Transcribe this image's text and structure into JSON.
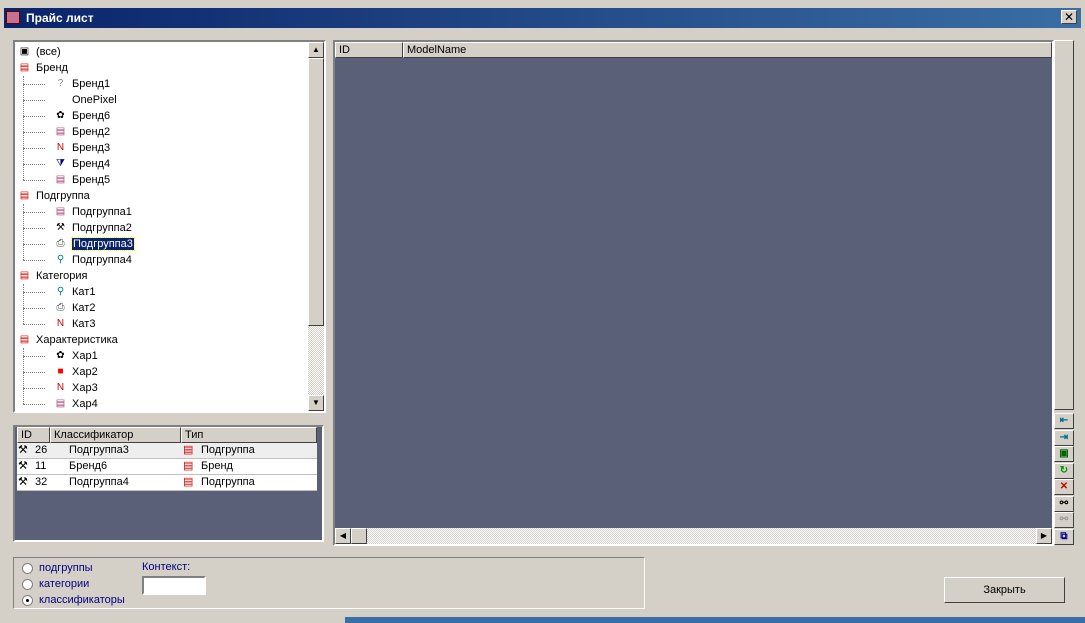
{
  "window": {
    "title": "Прайс лист"
  },
  "tree": {
    "items": [
      {
        "label": "(все)",
        "level": 0,
        "icon": "all-icon"
      },
      {
        "label": "Бренд",
        "level": 0,
        "icon": "md-folder-icon"
      },
      {
        "label": "Бренд1",
        "level": 1,
        "icon": "question-icon"
      },
      {
        "label": "OnePixel",
        "level": 1,
        "icon": "none"
      },
      {
        "label": "Бренд6",
        "level": 1,
        "icon": "flower-icon"
      },
      {
        "label": "Бренд2",
        "level": 1,
        "icon": "form-icon"
      },
      {
        "label": "Бренд3",
        "level": 1,
        "icon": "new-badge-icon"
      },
      {
        "label": "Бренд4",
        "level": 1,
        "icon": "filter-icon"
      },
      {
        "label": "Бренд5",
        "level": 1,
        "icon": "form-icon"
      },
      {
        "label": "Подгруппа",
        "level": 0,
        "icon": "md-folder-icon"
      },
      {
        "label": "Подгруппа1",
        "level": 1,
        "icon": "form-icon"
      },
      {
        "label": "Подгруппа2",
        "level": 1,
        "icon": "tools-icon"
      },
      {
        "label": "Подгруппа3",
        "level": 1,
        "icon": "printer-icon",
        "selected": true
      },
      {
        "label": "Подгруппа4",
        "level": 1,
        "icon": "tool-icon"
      },
      {
        "label": "Категория",
        "level": 0,
        "icon": "md-folder-icon"
      },
      {
        "label": "Кат1",
        "level": 1,
        "icon": "tool-icon"
      },
      {
        "label": "Кат2",
        "level": 1,
        "icon": "printer-icon"
      },
      {
        "label": "Кат3",
        "level": 1,
        "icon": "new-badge-icon"
      },
      {
        "label": "Характеристика",
        "level": 0,
        "icon": "md-folder-icon"
      },
      {
        "label": "Хар1",
        "level": 1,
        "icon": "flower-icon"
      },
      {
        "label": "Хар2",
        "level": 1,
        "icon": "red-square-icon"
      },
      {
        "label": "Хар3",
        "level": 1,
        "icon": "new-badge-icon"
      },
      {
        "label": "Хар4",
        "level": 1,
        "icon": "form-icon"
      }
    ]
  },
  "classifier_grid": {
    "columns": [
      "ID",
      "Классификатор",
      "Тип"
    ],
    "rows": [
      {
        "id": "26",
        "name": "Подгруппа3",
        "type": "Подгруппа"
      },
      {
        "id": "11",
        "name": "Бренд6",
        "type": "Бренд"
      },
      {
        "id": "32",
        "name": "Подгруппа4",
        "type": "Подгруппа"
      }
    ]
  },
  "main_grid": {
    "columns": [
      "ID",
      "ModelName"
    ]
  },
  "toolbar": [
    "arrow-left-icon",
    "arrow-right-icon",
    "save-icon",
    "refresh-icon",
    "delete-icon",
    "find-icon",
    "find-next-icon",
    "copy-icon"
  ],
  "filter": {
    "options": [
      "подгруппы",
      "категории",
      "классификаторы"
    ],
    "selected": "классификаторы",
    "context_label": "Контекст:",
    "context_value": ""
  },
  "close_label": "Закрыть"
}
